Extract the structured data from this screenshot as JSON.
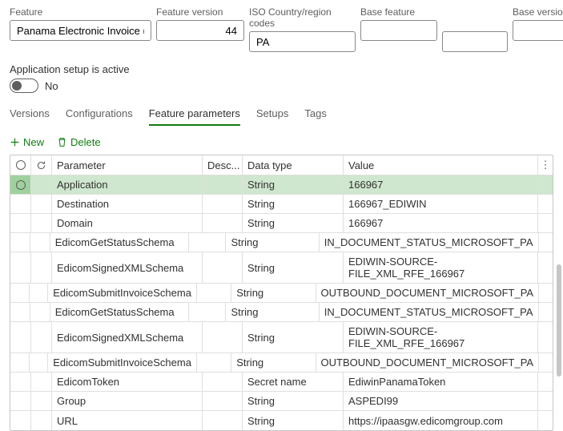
{
  "header": {
    "featureLabel": "Feature",
    "featureValue": "Panama Electronic Invoice (PA)",
    "versionLabel": "Feature version",
    "versionValue": "44",
    "isoLabel": "ISO Country/region codes",
    "isoValue": "PA",
    "baseFeatureLabel": "Base feature",
    "baseFeatureValue": "",
    "baseVersionLabel": "Base version",
    "baseVersionValue": ""
  },
  "status": {
    "label": "Application setup is active",
    "value": "No"
  },
  "tabs": [
    "Versions",
    "Configurations",
    "Feature parameters",
    "Setups",
    "Tags"
  ],
  "activeTab": 2,
  "toolbar": {
    "new": "New",
    "delete": "Delete"
  },
  "columns": {
    "parameter": "Parameter",
    "desc": "Desc...",
    "dataType": "Data type",
    "value": "Value"
  },
  "rows": [
    {
      "param": "Application",
      "type": "String",
      "value": "166967",
      "selected": true
    },
    {
      "param": "Destination",
      "type": "String",
      "value": "166967_EDIWIN"
    },
    {
      "param": "Domain",
      "type": "String",
      "value": "166967"
    },
    {
      "param": "EdicomGetStatusSchema",
      "type": "String",
      "value": "IN_DOCUMENT_STATUS_MICROSOFT_PA"
    },
    {
      "param": "EdicomSignedXMLSchema",
      "type": "String",
      "value": "EDIWIN-SOURCE-FILE_XML_RFE_166967"
    },
    {
      "param": "EdicomSubmitInvoiceSchema",
      "type": "String",
      "value": "OUTBOUND_DOCUMENT_MICROSOFT_PA"
    },
    {
      "param": "EdicomGetStatusSchema",
      "type": "String",
      "value": "IN_DOCUMENT_STATUS_MICROSOFT_PA"
    },
    {
      "param": "EdicomSignedXMLSchema",
      "type": "String",
      "value": "EDIWIN-SOURCE-FILE_XML_RFE_166967"
    },
    {
      "param": "EdicomSubmitInvoiceSchema",
      "type": "String",
      "value": "OUTBOUND_DOCUMENT_MICROSOFT_PA"
    },
    {
      "param": "EdicomToken",
      "type": "Secret name",
      "value": "EdiwinPanamaToken"
    },
    {
      "param": "Group",
      "type": "String",
      "value": "ASPEDI99"
    },
    {
      "param": "URL",
      "type": "String",
      "value": "https://ipaasgw.edicomgroup.com"
    }
  ]
}
